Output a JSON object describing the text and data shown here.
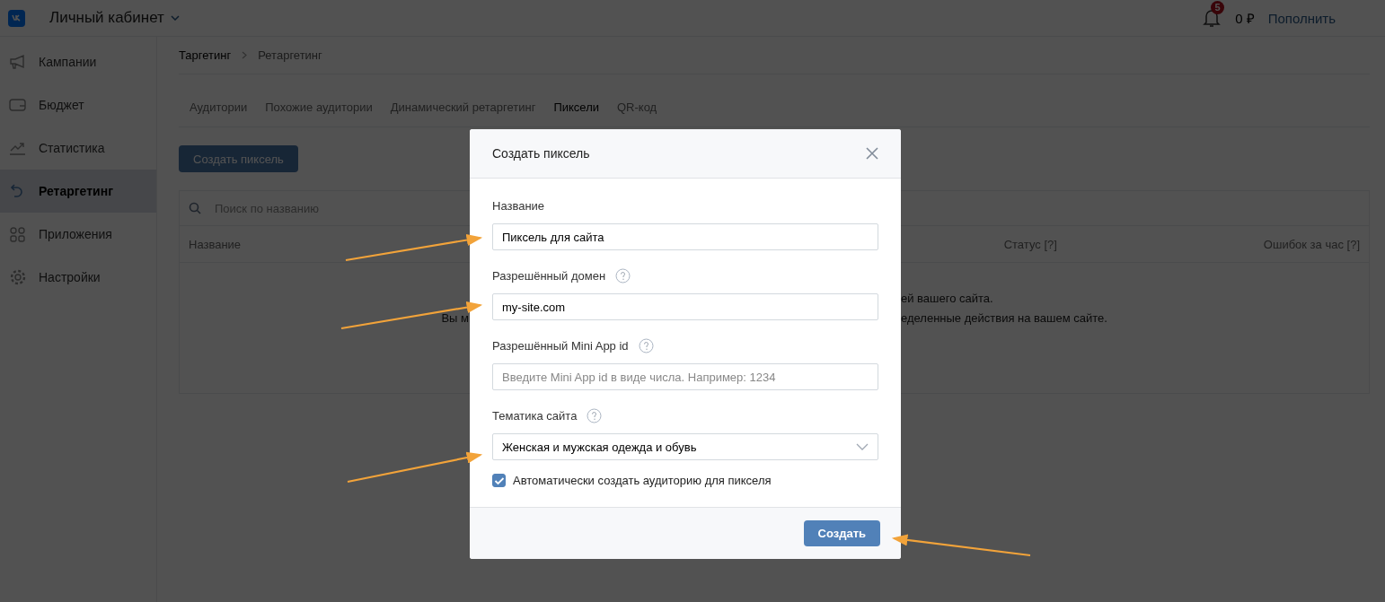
{
  "header": {
    "title": "Личный кабинет",
    "notification_count": "5",
    "balance": "0 ₽",
    "top_up": "Пополнить"
  },
  "sidebar": {
    "items": [
      {
        "label": "Кампании",
        "selected": false
      },
      {
        "label": "Бюджет",
        "selected": false
      },
      {
        "label": "Статистика",
        "selected": false
      },
      {
        "label": "Ретаргетинг",
        "selected": true
      },
      {
        "label": "Приложения",
        "selected": false
      },
      {
        "label": "Настройки",
        "selected": false
      }
    ]
  },
  "breadcrumbs": [
    "Таргетинг",
    "Ретаргетинг"
  ],
  "tabs": [
    {
      "label": "Аудитории",
      "selected": false
    },
    {
      "label": "Похожие аудитории",
      "selected": false
    },
    {
      "label": "Динамический ретаргетинг",
      "selected": false
    },
    {
      "label": "Пиксели",
      "selected": true
    },
    {
      "label": "QR-код",
      "selected": false
    }
  ],
  "create_button": "Создать пиксель",
  "search": {
    "placeholder": "Поиск по названию"
  },
  "table": {
    "columns": [
      "Название",
      "Статус [?]",
      "Ошибок за час [?]"
    ]
  },
  "empty_state": {
    "line_1_end": "ей вашего сайта.",
    "line_2_start": "Вы м",
    "line_2_end": "еделенные действия на вашем сайте."
  },
  "modal": {
    "title": "Создать пиксель",
    "fields": [
      {
        "kind": "input",
        "label": "Название",
        "help": false,
        "value": "Пиксель для сайта"
      },
      {
        "kind": "input",
        "label": "Разрешённый домен",
        "help": true,
        "value": "my-site.com"
      },
      {
        "kind": "input",
        "label": "Разрешённый Mini App id",
        "help": true,
        "placeholder": "Введите Mini App id в виде числа. Например: 1234"
      },
      {
        "kind": "select",
        "label": "Тематика сайта",
        "help": true,
        "value": "Женская и мужская одежда и обувь"
      }
    ],
    "checkbox": {
      "label": "Автоматически создать аудиторию для пикселя",
      "checked": true
    },
    "submit": "Создать"
  }
}
